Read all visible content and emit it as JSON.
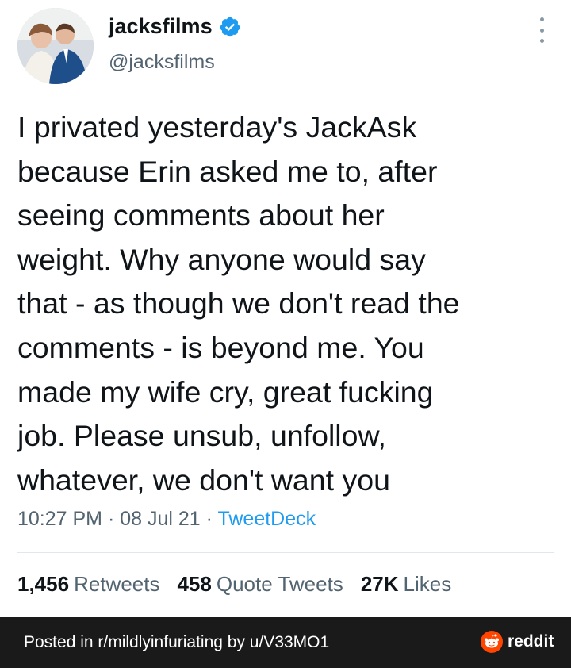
{
  "tweet": {
    "display_name": "jacksfilms",
    "handle": "@jacksfilms",
    "text": "I privated yesterday's JackAsk\nbecause Erin asked me to, after\nseeing comments about her\nweight. Why anyone would say\nthat - as though we don't read the\ncomments - is beyond me. You\nmade my wife cry, great fucking\njob. Please unsub, unfollow,\nwhatever, we don't want you",
    "time": "10:27 PM",
    "date": "08 Jul 21",
    "source": "TweetDeck",
    "sep": " · ",
    "retweets_count": "1,456",
    "retweets_label": "Retweets",
    "quotes_count": "458",
    "quotes_label": "Quote Tweets",
    "likes_count": "27K",
    "likes_label": "Likes",
    "verified_icon": "verified-badge-icon",
    "more_icon": "more-options-icon"
  },
  "footer": {
    "posted_text": "Posted in r/mildlyinfuriating by u/V33MO1",
    "brand": "reddit",
    "brand_icon": "reddit-alien-icon"
  },
  "colors": {
    "accent": "#1d9bf0",
    "secondary_text": "#536471",
    "footer_bg": "#1a1a1b",
    "reddit_orange": "#ff4500"
  }
}
